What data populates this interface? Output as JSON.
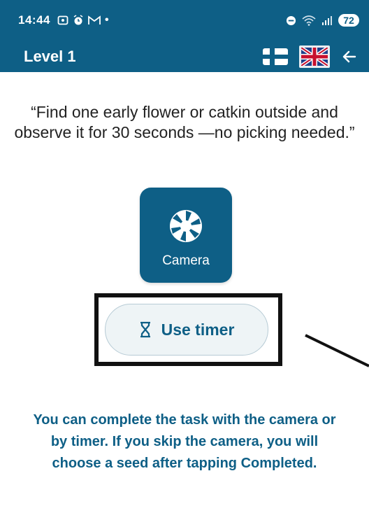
{
  "status_bar": {
    "time": "14:44",
    "battery": "72",
    "icons": [
      "screenshot-icon",
      "alarm-icon",
      "gmail-icon",
      "dot-icon",
      "dnd-icon",
      "wifi-icon",
      "signal-icon"
    ]
  },
  "app_bar": {
    "title": "Level 1",
    "flags": [
      "finnish-flag-icon",
      "uk-flag-icon"
    ],
    "selected_flag": "uk-flag-icon"
  },
  "task": {
    "quote": "“Find one early flower or catkin outside and observe it for 30 seconds —no picking needed.”"
  },
  "camera_tile": {
    "label": "Camera",
    "icon": "camera-shutter-icon"
  },
  "timer_button": {
    "label": "Use timer",
    "icon": "hourglass-icon"
  },
  "info_text": "You can complete the task with the camera or by timer. If you skip the camera, you will choose a seed after tapping Completed.",
  "colors": {
    "primary": "#0e5f86",
    "annotation": "#111111",
    "button_bg": "#eef4f6"
  }
}
